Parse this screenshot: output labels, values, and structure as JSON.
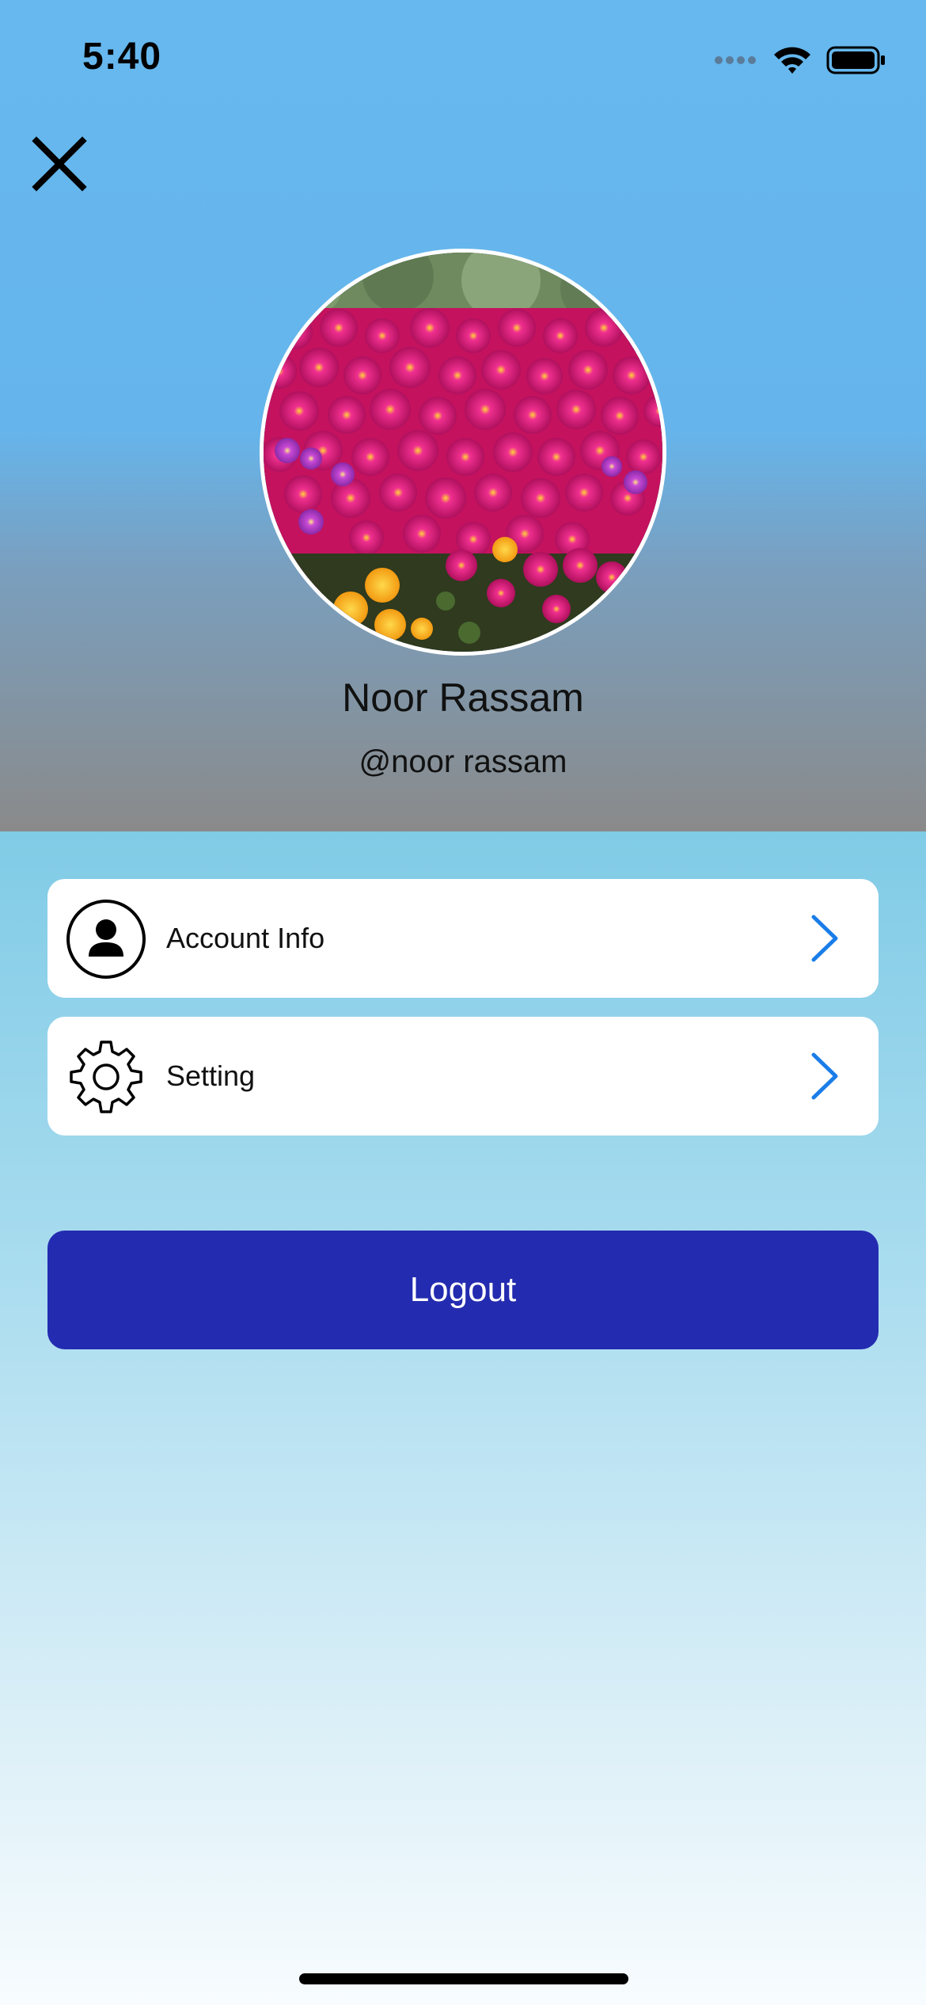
{
  "status_bar": {
    "time": "5:40",
    "icons": [
      "signal-dots-icon",
      "wifi-icon",
      "battery-icon"
    ]
  },
  "header": {
    "close_icon": "close-icon",
    "gradient_colors": [
      "#66b8ee",
      "#8a8a8a"
    ]
  },
  "profile": {
    "avatar_description": "avatar",
    "name": "Noor Rassam",
    "handle": "@noor rassam"
  },
  "menu": {
    "items": [
      {
        "label": "Account Info",
        "icon": "person-circle-icon",
        "chevron": "chevron-right-icon"
      },
      {
        "label": "Setting",
        "icon": "gear-icon",
        "chevron": "chevron-right-icon"
      }
    ]
  },
  "logout": {
    "label": "Logout",
    "color": "#232bb0"
  },
  "colors": {
    "accent_chevron": "#1a7de8",
    "card_background": "#ffffff",
    "body_top": "#80cbe6",
    "body_bottom": "#f8fcfe"
  }
}
